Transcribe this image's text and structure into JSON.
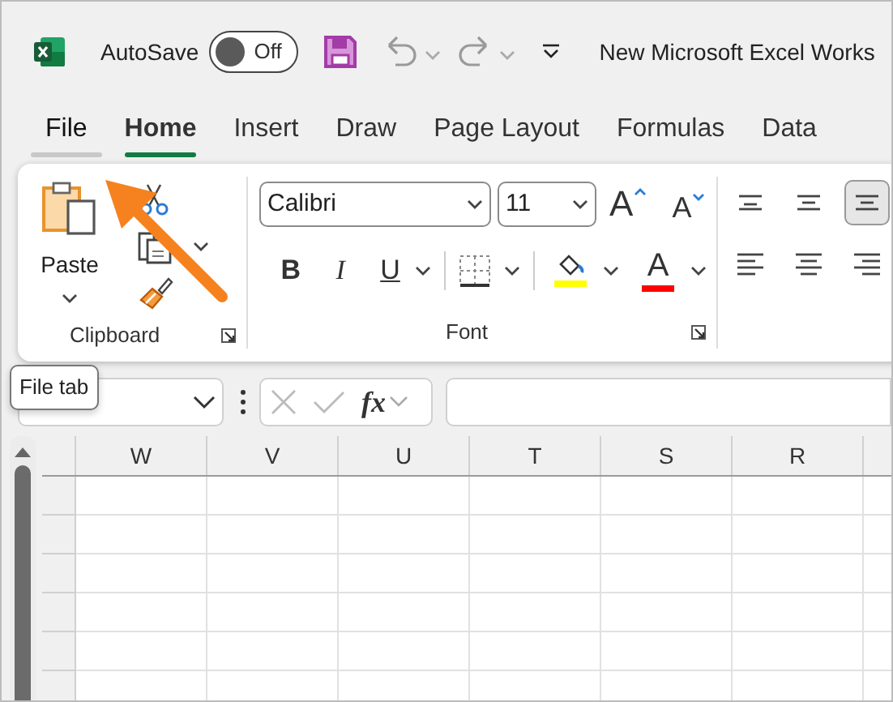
{
  "title_bar": {
    "autosave_label": "AutoSave",
    "autosave": {
      "on": false,
      "label": "Off"
    },
    "document_title": "New Microsoft Excel Works"
  },
  "tabs": [
    {
      "label": "File",
      "selected": false,
      "hovered": true
    },
    {
      "label": "Home",
      "selected": true,
      "hovered": false
    },
    {
      "label": "Insert",
      "selected": false,
      "hovered": false
    },
    {
      "label": "Draw",
      "selected": false,
      "hovered": false
    },
    {
      "label": "Page Layout",
      "selected": false,
      "hovered": false
    },
    {
      "label": "Formulas",
      "selected": false,
      "hovered": false
    },
    {
      "label": "Data",
      "selected": false,
      "hovered": false
    }
  ],
  "ribbon": {
    "clipboard": {
      "paste_label": "Paste",
      "group_label": "Clipboard"
    },
    "font": {
      "font_name": "Calibri",
      "font_size": "11",
      "grow_label": "A",
      "shrink_label": "A",
      "bold": "B",
      "italic": "I",
      "underline": "U",
      "group_label": "Font",
      "color_buttons": [
        {
          "kind": "fill",
          "color": "#ffff00"
        },
        {
          "kind": "font",
          "label": "A",
          "color": "#ff0000"
        }
      ]
    },
    "alignment": [
      {
        "kind": "top",
        "selected": false
      },
      {
        "kind": "middle",
        "selected": false
      },
      {
        "kind": "bottom",
        "selected": true
      },
      {
        "kind": "left",
        "selected": false
      },
      {
        "kind": "center",
        "selected": false
      },
      {
        "kind": "right",
        "selected": false
      }
    ]
  },
  "tooltip": "File tab",
  "formula_bar": {
    "function_label": "fx"
  },
  "sheet": {
    "columns": [
      "W",
      "V",
      "U",
      "T",
      "S",
      "R"
    ]
  }
}
